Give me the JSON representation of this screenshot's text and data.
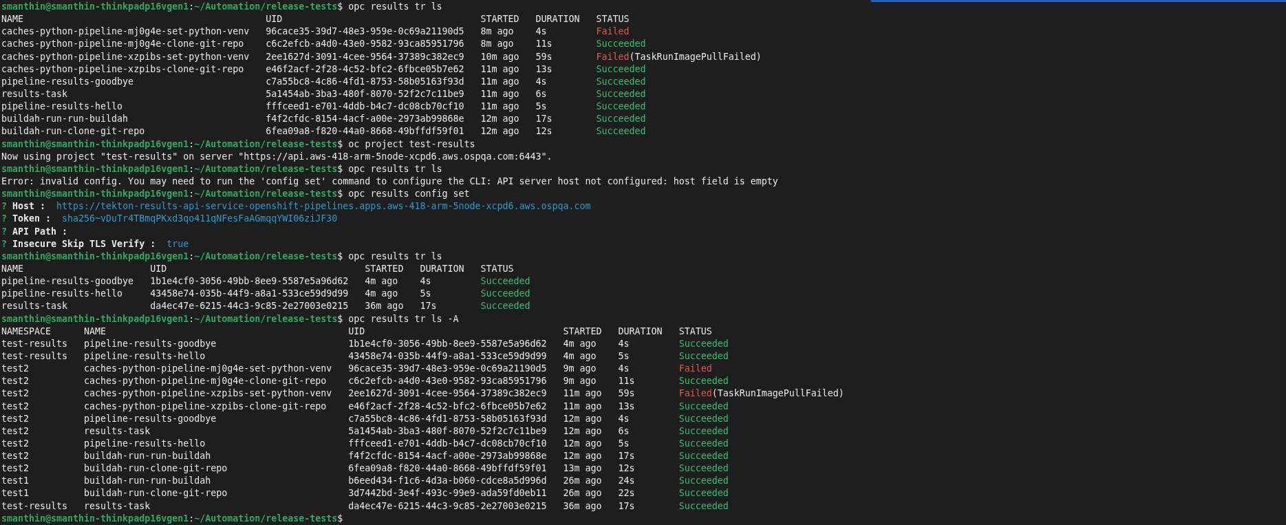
{
  "terminal": {
    "blocks": [
      {
        "kind": "prompt",
        "user_host": "smanthin@smanthin-thinkpadp16vgen1",
        "separator": ":",
        "path": "~/Automation/release-tests",
        "symbol": "$",
        "command": "opc results tr ls"
      },
      {
        "kind": "table",
        "columns": [
          "NAME",
          "UID",
          "STARTED",
          "DURATION",
          "STATUS"
        ],
        "rows": [
          {
            "cells": [
              "caches-python-pipeline-mj0g4e-set-python-venv",
              "96cace35-39d7-48e3-959e-0c69a21190d5",
              "8m ago",
              "4s"
            ],
            "status": "Failed",
            "color": "#e5574b"
          },
          {
            "cells": [
              "caches-python-pipeline-mj0g4e-clone-git-repo",
              "c6c2efcb-a4d0-43e0-9582-93ca85951796",
              "8m ago",
              "11s"
            ],
            "status": "Succeeded",
            "color": "#33c173"
          },
          {
            "cells": [
              "caches-python-pipeline-xzpibs-set-python-venv",
              "2ee1627d-3091-4cee-9564-37389c382ec9",
              "10m ago",
              "59s"
            ],
            "status": "Failed",
            "color": "#e5574b",
            "detail": "(TaskRunImagePullFailed)"
          },
          {
            "cells": [
              "caches-python-pipeline-xzpibs-clone-git-repo",
              "e46f2acf-2f28-4c52-bfc2-6fbce05b7e62",
              "11m ago",
              "13s"
            ],
            "status": "Succeeded",
            "color": "#33c173"
          },
          {
            "cells": [
              "pipeline-results-goodbye",
              "c7a55bc8-4c86-4fd1-8753-58b05163f93d",
              "11m ago",
              "4s"
            ],
            "status": "Succeeded",
            "color": "#33c173"
          },
          {
            "cells": [
              "results-task",
              "5a1454ab-3ba3-480f-8070-52f2c7c11be9",
              "11m ago",
              "6s"
            ],
            "status": "Succeeded",
            "color": "#33c173"
          },
          {
            "cells": [
              "pipeline-results-hello",
              "fffceed1-e701-4ddb-b4c7-dc08cb70cf10",
              "11m ago",
              "5s"
            ],
            "status": "Succeeded",
            "color": "#33c173"
          },
          {
            "cells": [
              "buildah-run-run-buildah",
              "f4f2cfdc-8154-4acf-a00e-2973ab99868e",
              "12m ago",
              "17s"
            ],
            "status": "Succeeded",
            "color": "#33c173"
          },
          {
            "cells": [
              "buildah-run-clone-git-repo",
              "6fea09a8-f820-44a0-8668-49bffdf59f01",
              "12m ago",
              "12s"
            ],
            "status": "Succeeded",
            "color": "#33c173"
          }
        ]
      },
      {
        "kind": "prompt",
        "user_host": "smanthin@smanthin-thinkpadp16vgen1",
        "separator": ":",
        "path": "~/Automation/release-tests",
        "symbol": "$",
        "command": "oc project test-results"
      },
      {
        "kind": "output",
        "text": "Now using project \"test-results\" on server \"https://api.aws-418-arm-5node-xcpd6.aws.ospqa.com:6443\"."
      },
      {
        "kind": "prompt",
        "user_host": "smanthin@smanthin-thinkpadp16vgen1",
        "separator": ":",
        "path": "~/Automation/release-tests",
        "symbol": "$",
        "command": "opc results tr ls"
      },
      {
        "kind": "output",
        "text": "Error: invalid config. You may need to run the 'config set' command to configure the CLI: API server host not configured: host field is empty"
      },
      {
        "kind": "prompt",
        "user_host": "smanthin@smanthin-thinkpadp16vgen1",
        "separator": ":",
        "path": "~/Automation/release-tests",
        "symbol": "$",
        "command": "opc results config set"
      },
      {
        "kind": "question",
        "mark": "?",
        "label": "Host :",
        "value": "https://tekton-results-api-service-openshift-pipelines.apps.aws-418-arm-5node-xcpd6.aws.ospqa.com"
      },
      {
        "kind": "question",
        "mark": "?",
        "label": "Token :",
        "value": "sha256~vDuTr4TBmqPKxd3qo411qNFesFaAGmqqYWI06ziJF30"
      },
      {
        "kind": "question",
        "mark": "?",
        "label": "API Path :"
      },
      {
        "kind": "question",
        "mark": "?",
        "label": "Insecure Skip TLS Verify :",
        "value": "true"
      },
      {
        "kind": "prompt",
        "user_host": "smanthin@smanthin-thinkpadp16vgen1",
        "separator": ":",
        "path": "~/Automation/release-tests",
        "symbol": "$",
        "command": "opc results tr ls"
      },
      {
        "kind": "table",
        "columns": [
          "NAME",
          "UID",
          "STARTED",
          "DURATION",
          "STATUS"
        ],
        "rows": [
          {
            "cells": [
              "pipeline-results-goodbye",
              "1b1e4cf0-3056-49bb-8ee9-5587e5a96d62",
              "4m ago",
              "4s"
            ],
            "status": "Succeeded",
            "color": "#33c173"
          },
          {
            "cells": [
              "pipeline-results-hello",
              "43458e74-035b-44f9-a8a1-533ce59d9d99",
              "4m ago",
              "5s"
            ],
            "status": "Succeeded",
            "color": "#33c173"
          },
          {
            "cells": [
              "results-task",
              "da4ec47e-6215-44c3-9c85-2e27003e0215",
              "36m ago",
              "17s"
            ],
            "status": "Succeeded",
            "color": "#33c173"
          }
        ]
      },
      {
        "kind": "prompt",
        "user_host": "smanthin@smanthin-thinkpadp16vgen1",
        "separator": ":",
        "path": "~/Automation/release-tests",
        "symbol": "$",
        "command": "opc results tr ls -A"
      },
      {
        "kind": "table",
        "columns": [
          "NAMESPACE",
          "NAME",
          "UID",
          "STARTED",
          "DURATION",
          "STATUS"
        ],
        "rows": [
          {
            "cells": [
              "test-results",
              "pipeline-results-goodbye",
              "1b1e4cf0-3056-49bb-8ee9-5587e5a96d62",
              "4m ago",
              "4s"
            ],
            "status": "Succeeded",
            "color": "#33c173"
          },
          {
            "cells": [
              "test-results",
              "pipeline-results-hello",
              "43458e74-035b-44f9-a8a1-533ce59d9d99",
              "4m ago",
              "5s"
            ],
            "status": "Succeeded",
            "color": "#33c173"
          },
          {
            "cells": [
              "test2",
              "caches-python-pipeline-mj0g4e-set-python-venv",
              "96cace35-39d7-48e3-959e-0c69a21190d5",
              "9m ago",
              "4s"
            ],
            "status": "Failed",
            "color": "#e5574b"
          },
          {
            "cells": [
              "test2",
              "caches-python-pipeline-mj0g4e-clone-git-repo",
              "c6c2efcb-a4d0-43e0-9582-93ca85951796",
              "9m ago",
              "11s"
            ],
            "status": "Succeeded",
            "color": "#33c173"
          },
          {
            "cells": [
              "test2",
              "caches-python-pipeline-xzpibs-set-python-venv",
              "2ee1627d-3091-4cee-9564-37389c382ec9",
              "11m ago",
              "59s"
            ],
            "status": "Failed",
            "color": "#e5574b",
            "detail": "(TaskRunImagePullFailed)"
          },
          {
            "cells": [
              "test2",
              "caches-python-pipeline-xzpibs-clone-git-repo",
              "e46f2acf-2f28-4c52-bfc2-6fbce05b7e62",
              "11m ago",
              "13s"
            ],
            "status": "Succeeded",
            "color": "#33c173"
          },
          {
            "cells": [
              "test2",
              "pipeline-results-goodbye",
              "c7a55bc8-4c86-4fd1-8753-58b05163f93d",
              "12m ago",
              "4s"
            ],
            "status": "Succeeded",
            "color": "#33c173"
          },
          {
            "cells": [
              "test2",
              "results-task",
              "5a1454ab-3ba3-480f-8070-52f2c7c11be9",
              "12m ago",
              "6s"
            ],
            "status": "Succeeded",
            "color": "#33c173"
          },
          {
            "cells": [
              "test2",
              "pipeline-results-hello",
              "fffceed1-e701-4ddb-b4c7-dc08cb70cf10",
              "12m ago",
              "5s"
            ],
            "status": "Succeeded",
            "color": "#33c173"
          },
          {
            "cells": [
              "test2",
              "buildah-run-run-buildah",
              "f4f2cfdc-8154-4acf-a00e-2973ab99868e",
              "12m ago",
              "17s"
            ],
            "status": "Succeeded",
            "color": "#33c173"
          },
          {
            "cells": [
              "test2",
              "buildah-run-clone-git-repo",
              "6fea09a8-f820-44a0-8668-49bffdf59f01",
              "13m ago",
              "12s"
            ],
            "status": "Succeeded",
            "color": "#33c173"
          },
          {
            "cells": [
              "test1",
              "buildah-run-run-buildah",
              "b6eed434-f1c6-4d3a-b060-cdce8a5d996d",
              "26m ago",
              "24s"
            ],
            "status": "Succeeded",
            "color": "#33c173"
          },
          {
            "cells": [
              "test1",
              "buildah-run-clone-git-repo",
              "3d7442bd-3e4f-493c-99e9-ada59fd0eb11",
              "26m ago",
              "22s"
            ],
            "status": "Succeeded",
            "color": "#33c173"
          },
          {
            "cells": [
              "test-results",
              "results-task",
              "da4ec47e-6215-44c3-9c85-2e27003e0215",
              "36m ago",
              "17s"
            ],
            "status": "Succeeded",
            "color": "#33c173"
          }
        ]
      },
      {
        "kind": "prompt",
        "user_host": "smanthin@smanthin-thinkpadp16vgen1",
        "separator": ":",
        "path": "~/Automation/release-tests",
        "symbol": "$"
      }
    ]
  }
}
